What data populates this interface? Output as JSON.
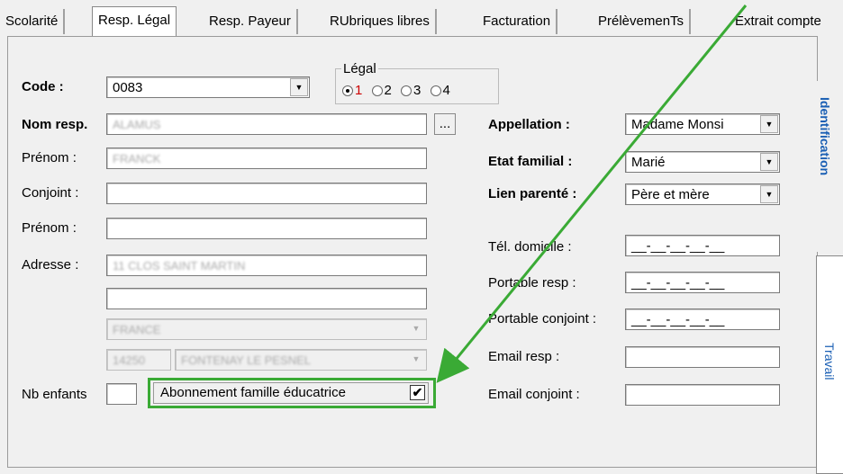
{
  "tabs": [
    "Scolarité",
    "Resp. Légal",
    "Resp. Payeur",
    "RUbriques libres",
    "Facturation",
    "PrélèvemenTs",
    "Extrait compte"
  ],
  "code": {
    "label": "Code :",
    "value": "0083"
  },
  "legal": {
    "legend": "Légal",
    "options": [
      "1",
      "2",
      "3",
      "4"
    ],
    "selected": "1"
  },
  "left_fields": {
    "nom_label": "Nom resp.",
    "nom_value": "ALAMUS",
    "browse_label": "...",
    "prenom_label": "Prénom :",
    "prenom_value": "FRANCK",
    "conjoint_label": "Conjoint :",
    "conjoint_value": "",
    "prenom2_label": "Prénom :",
    "prenom2_value": "",
    "adresse_label": "Adresse :",
    "adresse1": "11 CLOS SAINT MARTIN",
    "adresse2": "",
    "pays": "FRANCE",
    "cp": "14250",
    "ville": "FONTENAY LE PESNEL",
    "nb_enfants_label": "Nb enfants",
    "nb_enfants_value": "",
    "abonnement_label": "Abonnement famille éducatrice",
    "abonnement_checked": true
  },
  "right_fields": {
    "appellation_label": "Appellation :",
    "appellation_value": "Madame Monsi",
    "etat_label": "Etat familial :",
    "etat_value": "Marié",
    "lien_label": "Lien parenté :",
    "lien_value": "Père et mère",
    "tel_label": "Tél. domicile :",
    "tel_value": "__-__-__-__-__",
    "portable_label": "Portable resp :",
    "portable_value": "__-__-__-__-__",
    "portable_conj_label": "Portable conjoint :",
    "portable_conj_value": "__-__-__-__-__",
    "email_label": "Email resp :",
    "email_value": "",
    "email_conj_label": "Email conjoint :",
    "email_conj_value": ""
  },
  "side_tabs": {
    "identification": "Identification",
    "travail": "Travail"
  },
  "colors": {
    "highlight": "#3aaa35",
    "link_blue": "#1a5fb4",
    "radio_red": "#cc0000"
  }
}
